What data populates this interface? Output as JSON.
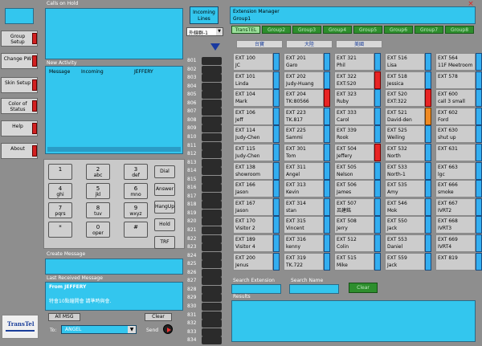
{
  "left_buttons": [
    {
      "label": "Group Setup"
    },
    {
      "label": "Change PW"
    },
    {
      "label": "Skin Setup"
    },
    {
      "label": "Color of Status"
    },
    {
      "label": "Help"
    },
    {
      "label": "About"
    }
  ],
  "calls_on_hold": {
    "title": "Calls on Hold"
  },
  "new_activity": {
    "title": "New Activity",
    "col1": "Message",
    "col2": "Incoming",
    "col3": "JEFFERY"
  },
  "keypad": [
    {
      "main": "1",
      "sub": ""
    },
    {
      "main": "2",
      "sub": "abc"
    },
    {
      "main": "3",
      "sub": "def"
    },
    {
      "main": "4",
      "sub": "ghi"
    },
    {
      "main": "5",
      "sub": "jkl"
    },
    {
      "main": "6",
      "sub": "mno"
    },
    {
      "main": "7",
      "sub": "pqrs"
    },
    {
      "main": "8",
      "sub": "tuv"
    },
    {
      "main": "9",
      "sub": "wxyz"
    },
    {
      "main": "*",
      "sub": ""
    },
    {
      "main": "0",
      "sub": "oper"
    },
    {
      "main": "#",
      "sub": ""
    }
  ],
  "function_keys": [
    "Dial",
    "Answer",
    "HangUp",
    "Hold",
    "TRF"
  ],
  "create_message": {
    "title": "Create Message"
  },
  "last_received": {
    "title": "Last Received Message",
    "from": "From JEFFERY",
    "body": "特會10點鐘開會 請準時與會."
  },
  "all_msg_label": "All MSG",
  "clear_label": "Clear",
  "to_label": "To:",
  "to_value": "ANGEL",
  "send_label": "Send",
  "logo_text": "TransTel",
  "incoming_lines": {
    "label": "Incoming Lines",
    "select": "外線群-1"
  },
  "lines": [
    "801",
    "802",
    "803",
    "804",
    "805",
    "806",
    "807",
    "808",
    "809",
    "810",
    "811",
    "812",
    "813",
    "814",
    "815",
    "816",
    "817",
    "818",
    "819",
    "820",
    "821",
    "822",
    "823",
    "824",
    "825",
    "826",
    "827",
    "828",
    "829",
    "830",
    "831",
    "832",
    "833",
    "834"
  ],
  "extension_manager": {
    "title": "Extension Manager",
    "group": "Group1",
    "close": "×"
  },
  "tabs": [
    "TransTEL",
    "Group2",
    "Group3",
    "Group4",
    "Group5",
    "Group6",
    "Group7",
    "Group8"
  ],
  "subtabs": [
    "台寶",
    "大陸",
    "美國"
  ],
  "extensions": [
    [
      {
        "ext": "EXT 100",
        "name": "JC",
        "status": "blue"
      },
      {
        "ext": "EXT 101",
        "name": "Linda",
        "status": "blue"
      },
      {
        "ext": "EXT 104",
        "name": "Mark",
        "status": "blue"
      },
      {
        "ext": "EXT 106",
        "name": "Jeff",
        "status": "blue"
      },
      {
        "ext": "EXT 114",
        "name": "Judy-Chen",
        "status": "blue"
      },
      {
        "ext": "EXT 115",
        "name": "Judy-Chen",
        "status": "blue"
      },
      {
        "ext": "EXT 138",
        "name": "showroom",
        "status": "blue"
      },
      {
        "ext": "EXT 166",
        "name": "Jason",
        "status": "blue"
      },
      {
        "ext": "EXT 167",
        "name": "Jason",
        "status": "blue"
      },
      {
        "ext": "EXT 170",
        "name": "Visitor 2",
        "status": "blue"
      },
      {
        "ext": "EXT 189",
        "name": "Visitor 4",
        "status": "blue"
      },
      {
        "ext": "EXT 200",
        "name": "Jenus",
        "status": "blue"
      }
    ],
    [
      {
        "ext": "EXT 201",
        "name": "Garo",
        "status": "blue"
      },
      {
        "ext": "EXT 202",
        "name": "Judy-Huang",
        "status": "blue"
      },
      {
        "ext": "EXT 204",
        "name": "TK:80566",
        "status": "red"
      },
      {
        "ext": "EXT 223",
        "name": "TK.817",
        "status": "blue"
      },
      {
        "ext": "EXT 225",
        "name": "Sammi",
        "status": "blue"
      },
      {
        "ext": "EXT 301",
        "name": "Tom",
        "status": "blue"
      },
      {
        "ext": "EXT 311",
        "name": "Angel",
        "status": "blue"
      },
      {
        "ext": "EXT 313",
        "name": "Kevin",
        "status": "blue"
      },
      {
        "ext": "EXT 314",
        "name": "stan",
        "status": "blue"
      },
      {
        "ext": "EXT 315",
        "name": "Vincent",
        "status": "blue"
      },
      {
        "ext": "EXT 316",
        "name": "kenny",
        "status": "blue"
      },
      {
        "ext": "EXT 319",
        "name": "TK.722",
        "status": "blue"
      }
    ],
    [
      {
        "ext": "EXT 321",
        "name": "Phil",
        "status": "blue"
      },
      {
        "ext": "EXT 322",
        "name": "EXT:520",
        "status": "red"
      },
      {
        "ext": "EXT 323",
        "name": "Ruby",
        "status": "blue"
      },
      {
        "ext": "EXT 333",
        "name": "Carol",
        "status": "blue"
      },
      {
        "ext": "EXT 339",
        "name": "Rook",
        "status": "blue"
      },
      {
        "ext": "EXT 504",
        "name": "Jeffery",
        "status": "red"
      },
      {
        "ext": "EXT 505",
        "name": "Nelson",
        "status": "blue"
      },
      {
        "ext": "EXT 506",
        "name": "James",
        "status": "blue"
      },
      {
        "ext": "EXT 507",
        "name": "呂建銘",
        "status": "blue"
      },
      {
        "ext": "EXT 508",
        "name": "Jerry",
        "status": "blue"
      },
      {
        "ext": "EXT 512",
        "name": "Colin",
        "status": "blue"
      },
      {
        "ext": "EXT 515",
        "name": "Mike",
        "status": "blue"
      }
    ],
    [
      {
        "ext": "EXT 516",
        "name": "Lisa",
        "status": "blue"
      },
      {
        "ext": "EXT 518",
        "name": "Jessica",
        "status": "blue"
      },
      {
        "ext": "EXT 520",
        "name": "EXT:322",
        "status": "red"
      },
      {
        "ext": "EXT 521",
        "name": "David-den",
        "status": "orange"
      },
      {
        "ext": "EXT 525",
        "name": "Weiling",
        "status": "blue"
      },
      {
        "ext": "EXT 532",
        "name": "North",
        "status": "blue"
      },
      {
        "ext": "EXT 533",
        "name": "North-1",
        "status": "blue"
      },
      {
        "ext": "EXT 535",
        "name": "Amy",
        "status": "blue"
      },
      {
        "ext": "EXT 546",
        "name": "Mok",
        "status": "blue"
      },
      {
        "ext": "EXT 550",
        "name": "Jack",
        "status": "blue"
      },
      {
        "ext": "EXT 553",
        "name": "Daniel",
        "status": "blue"
      },
      {
        "ext": "EXT 559",
        "name": "Jack",
        "status": "blue"
      }
    ],
    [
      {
        "ext": "EXT 564",
        "name": "11F Meetroom",
        "status": "blue"
      },
      {
        "ext": "EXT 578",
        "name": "",
        "status": "blue"
      },
      {
        "ext": "EXT 600",
        "name": "call 3 small",
        "status": "blue"
      },
      {
        "ext": "EXT 602",
        "name": "Ford",
        "status": "blue"
      },
      {
        "ext": "EXT 630",
        "name": "shut up",
        "status": "blue"
      },
      {
        "ext": "EXT 631",
        "name": "",
        "status": "blue"
      },
      {
        "ext": "EXT 663",
        "name": "lgc",
        "status": "blue"
      },
      {
        "ext": "EXT 666",
        "name": "smoke",
        "status": "blue"
      },
      {
        "ext": "EXT 667",
        "name": "IVRT2",
        "status": "blue"
      },
      {
        "ext": "EXT 668",
        "name": "IVRT3",
        "status": "blue"
      },
      {
        "ext": "EXT 669",
        "name": "IVRT4",
        "status": "blue"
      },
      {
        "ext": "EXT 819",
        "name": "",
        "status": "blue"
      }
    ]
  ],
  "search": {
    "ext_label": "Search Extension",
    "name_label": "Search Name",
    "clear": "Clear"
  },
  "results_label": "Results",
  "colors": {
    "bg": "#8e8e8e",
    "cyan": "#33c6ee",
    "green_tab": "#2d8e2d",
    "status_blue": "#33aef0",
    "status_red": "#e82424",
    "status_orange": "#f08a22"
  }
}
